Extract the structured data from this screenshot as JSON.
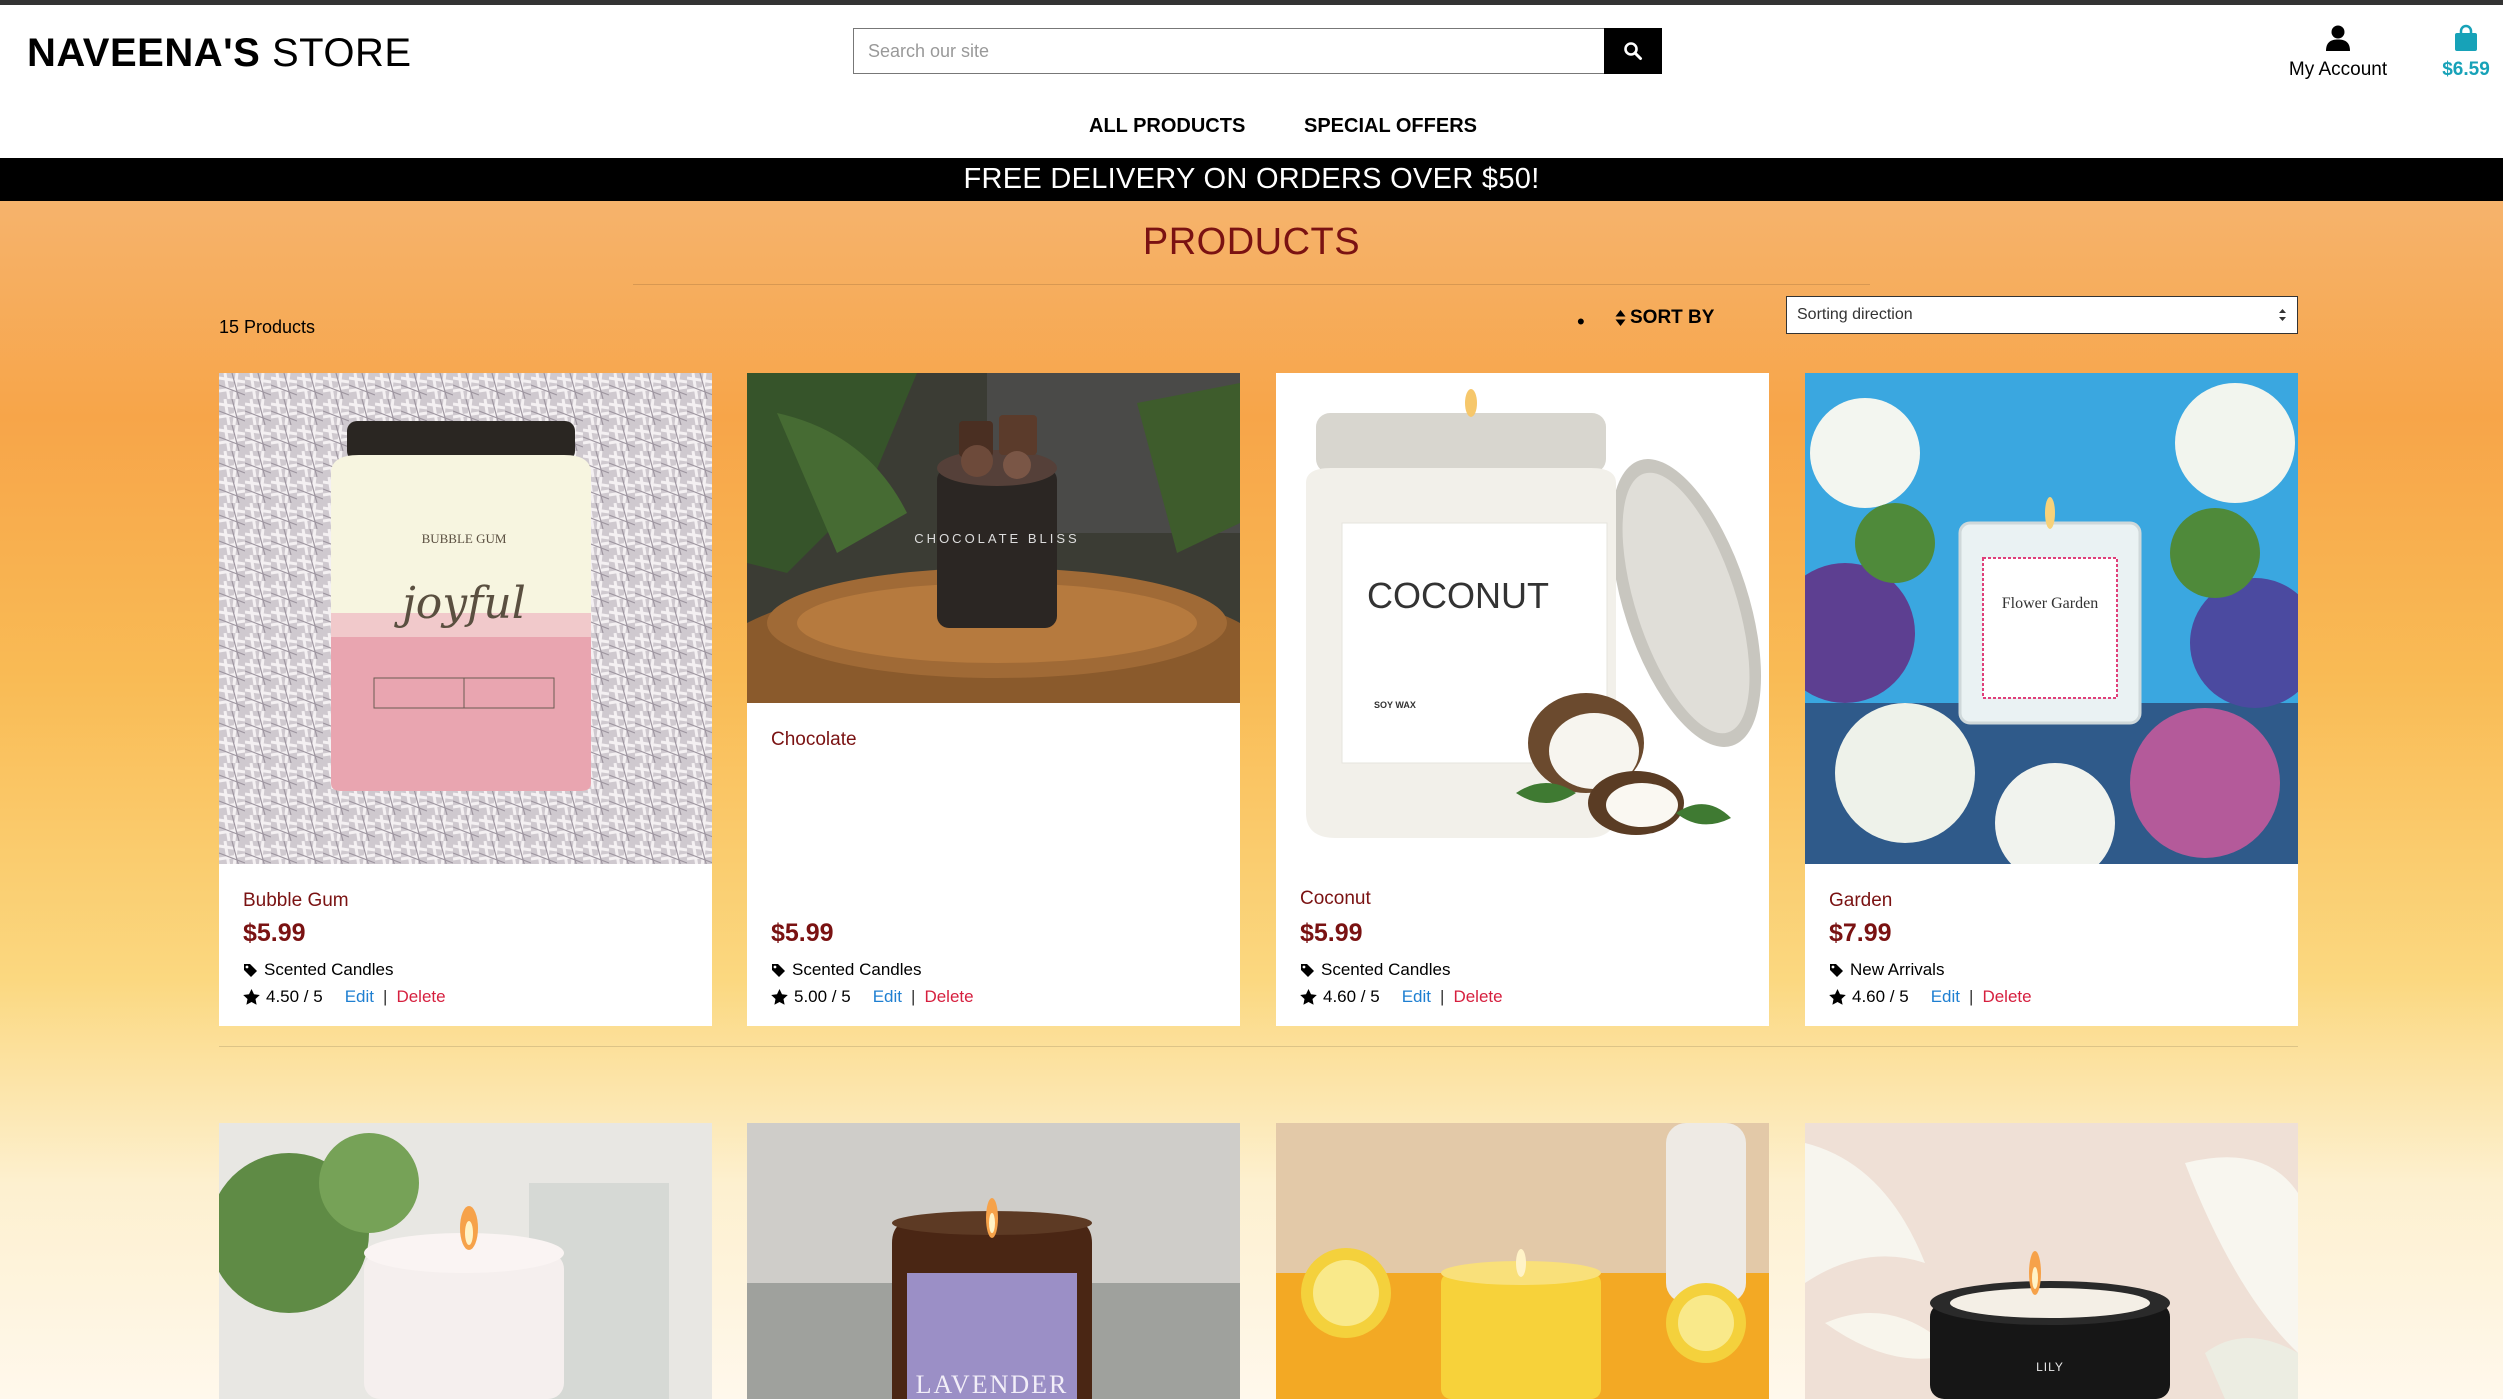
{
  "brand": {
    "bold": "NAVEENA'S",
    "light": "STORE"
  },
  "search": {
    "placeholder": "Search our site"
  },
  "account": {
    "label": "My Account"
  },
  "bag": {
    "total": "$6.59"
  },
  "nav": {
    "all_products": "ALL PRODUCTS",
    "special_offers": "SPECIAL OFFERS"
  },
  "banner": {
    "text": "FREE DELIVERY ON ORDERS OVER $50!"
  },
  "page": {
    "title": "PRODUCTS",
    "count": "15 Products",
    "sort_label": "SORT BY",
    "sort_value": "Sorting direction"
  },
  "products": [
    {
      "name": "Bubble Gum",
      "price": "$5.99",
      "category": "Scented Candles",
      "rating": "4.50 / 5",
      "edit": "Edit",
      "delete": "Delete"
    },
    {
      "name": "Chocolate",
      "price": "$5.99",
      "category": "Scented Candles",
      "rating": "5.00 / 5",
      "edit": "Edit",
      "delete": "Delete"
    },
    {
      "name": "Coconut",
      "price": "$5.99",
      "category": "Scented Candles",
      "rating": "4.60 / 5",
      "edit": "Edit",
      "delete": "Delete"
    },
    {
      "name": "Garden",
      "price": "$7.99",
      "category": "New Arrivals",
      "rating": "4.60 / 5",
      "edit": "Edit",
      "delete": "Delete"
    }
  ],
  "image_text": {
    "bubble_gum_label": "BUBBLE GUM",
    "bubble_gum_script": "joyful",
    "chocolate_label": "CHOCOLATE BLISS",
    "coconut_label": "COCONUT",
    "coconut_sub": "SOY WAX",
    "garden_label": "Flower Garden",
    "lavender_label": "LAVENDER",
    "lily_label": "LILY"
  },
  "colors": {
    "accent": "#7a1212",
    "link": "#1e7fd1",
    "danger": "#d61f3e",
    "bag": "#17a2b8"
  }
}
